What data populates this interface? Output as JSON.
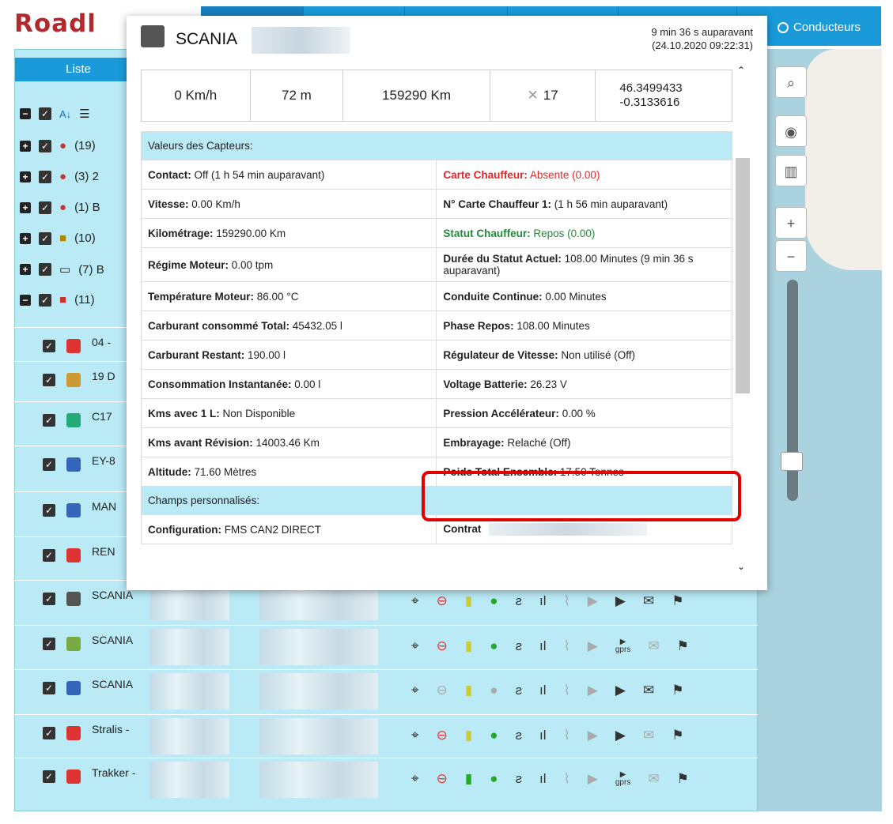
{
  "app": {
    "logo": "Roadl",
    "conducteurs": "Conducteurs"
  },
  "sidebar": {
    "liste_label": "Liste",
    "sort_icons": [
      "az-sort-icon",
      "list-icon"
    ],
    "groups": [
      {
        "count": "(19)"
      },
      {
        "count": "(3) 2"
      },
      {
        "count": "(1) B"
      },
      {
        "count": "(10)"
      },
      {
        "count": "(7) B"
      },
      {
        "count": "(11)"
      }
    ],
    "vehicles": [
      {
        "name": "04 -"
      },
      {
        "name": "19 D"
      },
      {
        "name": "C17"
      },
      {
        "name": "EY-8"
      },
      {
        "name": "MAN"
      },
      {
        "name": "REN"
      },
      {
        "name": "SCANIA"
      },
      {
        "name": "SCANIA"
      },
      {
        "name": "SCANIA"
      },
      {
        "name": "Stralis -"
      },
      {
        "name": "Trakker -"
      }
    ],
    "gprs_label": "gprs"
  },
  "popup": {
    "title": "SCANIA",
    "time_ago": "9 min 36 s auparavant",
    "timestamp": "(24.10.2020 09:22:31)",
    "stats": {
      "speed": "0 Km/h",
      "altitude": "72 m",
      "odometer": "159290 Km",
      "satellites": "17",
      "lat": "46.3499433",
      "lon": "-0.3133616"
    },
    "sensors_header": "Valeurs des Capteurs:",
    "sensors": [
      [
        {
          "label": "Contact:",
          "value": " Off (1 h 54 min auparavant)"
        },
        {
          "label": "Carte Chauffeur:",
          "value": " Absente (0.00)",
          "color": "red"
        }
      ],
      [
        {
          "label": "Vitesse:",
          "value": " 0.00 Km/h"
        },
        {
          "label": "N° Carte Chauffeur 1:",
          "value": " (1 h 56 min auparavant)"
        }
      ],
      [
        {
          "label": "Kilométrage:",
          "value": " 159290.00 Km"
        },
        {
          "label": "Statut Chauffeur:",
          "value": " Repos (0.00)",
          "color": "green"
        }
      ],
      [
        {
          "label": "Régime Moteur:",
          "value": " 0.00 tpm"
        },
        {
          "label": "Durée du Statut Actuel:",
          "value": " 108.00 Minutes (9 min 36 s auparavant)"
        }
      ],
      [
        {
          "label": "Température Moteur:",
          "value": " 86.00 °C"
        },
        {
          "label": "Conduite Continue:",
          "value": " 0.00 Minutes"
        }
      ],
      [
        {
          "label": "Carburant consommé Total:",
          "value": " 45432.05 l"
        },
        {
          "label": "Phase Repos:",
          "value": " 108.00 Minutes"
        }
      ],
      [
        {
          "label": "Carburant Restant:",
          "value": " 190.00 l"
        },
        {
          "label": "Régulateur de Vitesse:",
          "value": " Non utilisé (Off)"
        }
      ],
      [
        {
          "label": "Consommation Instantanée:",
          "value": " 0.00 l"
        },
        {
          "label": "Voltage Batterie:",
          "value": " 26.23 V"
        }
      ],
      [
        {
          "label": "Kms avec 1 L:",
          "value": " Non Disponible"
        },
        {
          "label": "Pression Accélérateur:",
          "value": " 0.00 %"
        }
      ],
      [
        {
          "label": "Kms avant Révision:",
          "value": " 14003.46 Km"
        },
        {
          "label": "Embrayage:",
          "value": " Relaché (Off)"
        }
      ],
      [
        {
          "label": "Altitude:",
          "value": " 71.60 Mètres"
        },
        {
          "label": "Poids Total Ensemble:",
          "value": " 17.50 Tonnes"
        }
      ]
    ],
    "custom_header": "Champs personnalisés:",
    "custom": [
      [
        {
          "label": "Configuration:",
          "value": " FMS CAN2 DIRECT"
        },
        {
          "label": "Contrat",
          "value": ""
        }
      ]
    ]
  },
  "colors": {
    "accent": "#1a9ad9",
    "panel": "#b9eaf6",
    "highlight": "#e00000",
    "red_text": "#e0282a",
    "green_text": "#228b3a"
  }
}
